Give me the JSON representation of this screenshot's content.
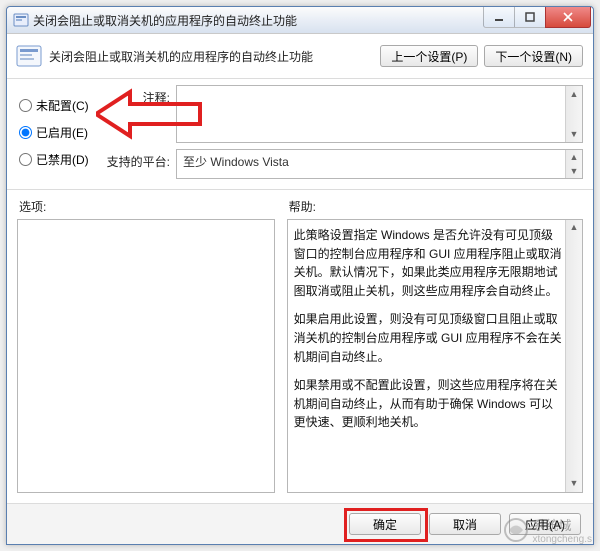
{
  "window": {
    "title": "关闭会阻止或取消关机的应用程序的自动终止功能"
  },
  "header": {
    "title": "关闭会阻止或取消关机的应用程序的自动终止功能",
    "prev_btn": "上一个设置(P)",
    "next_btn": "下一个设置(N)"
  },
  "radios": {
    "not_configured": "未配置(C)",
    "enabled": "已启用(E)",
    "disabled": "已禁用(D)",
    "selected": "enabled"
  },
  "fields": {
    "comment_label": "注释:",
    "platform_label": "支持的平台:",
    "platform_value": "至少 Windows Vista"
  },
  "columns": {
    "options_label": "选项:",
    "help_label": "帮助:"
  },
  "help_text": {
    "p1": "此策略设置指定 Windows 是否允许没有可见顶级窗口的控制台应用程序和 GUI 应用程序阻止或取消关机。默认情况下，如果此类应用程序无限期地试图取消或阻止关机，则这些应用程序会自动终止。",
    "p2": "如果启用此设置，则没有可见顶级窗口且阻止或取消关机的控制台应用程序或 GUI 应用程序不会在关机期间自动终止。",
    "p3": "如果禁用或不配置此设置，则这些应用程序将在关机期间自动终止，从而有助于确保 Windows 可以更快速、更顺利地关机。"
  },
  "footer": {
    "ok": "确定",
    "cancel": "取消",
    "apply": "应用(A)"
  },
  "watermark": {
    "brand": "系统城",
    "sub": "xtongcheng.s"
  },
  "colors": {
    "callout": "#e02020"
  }
}
